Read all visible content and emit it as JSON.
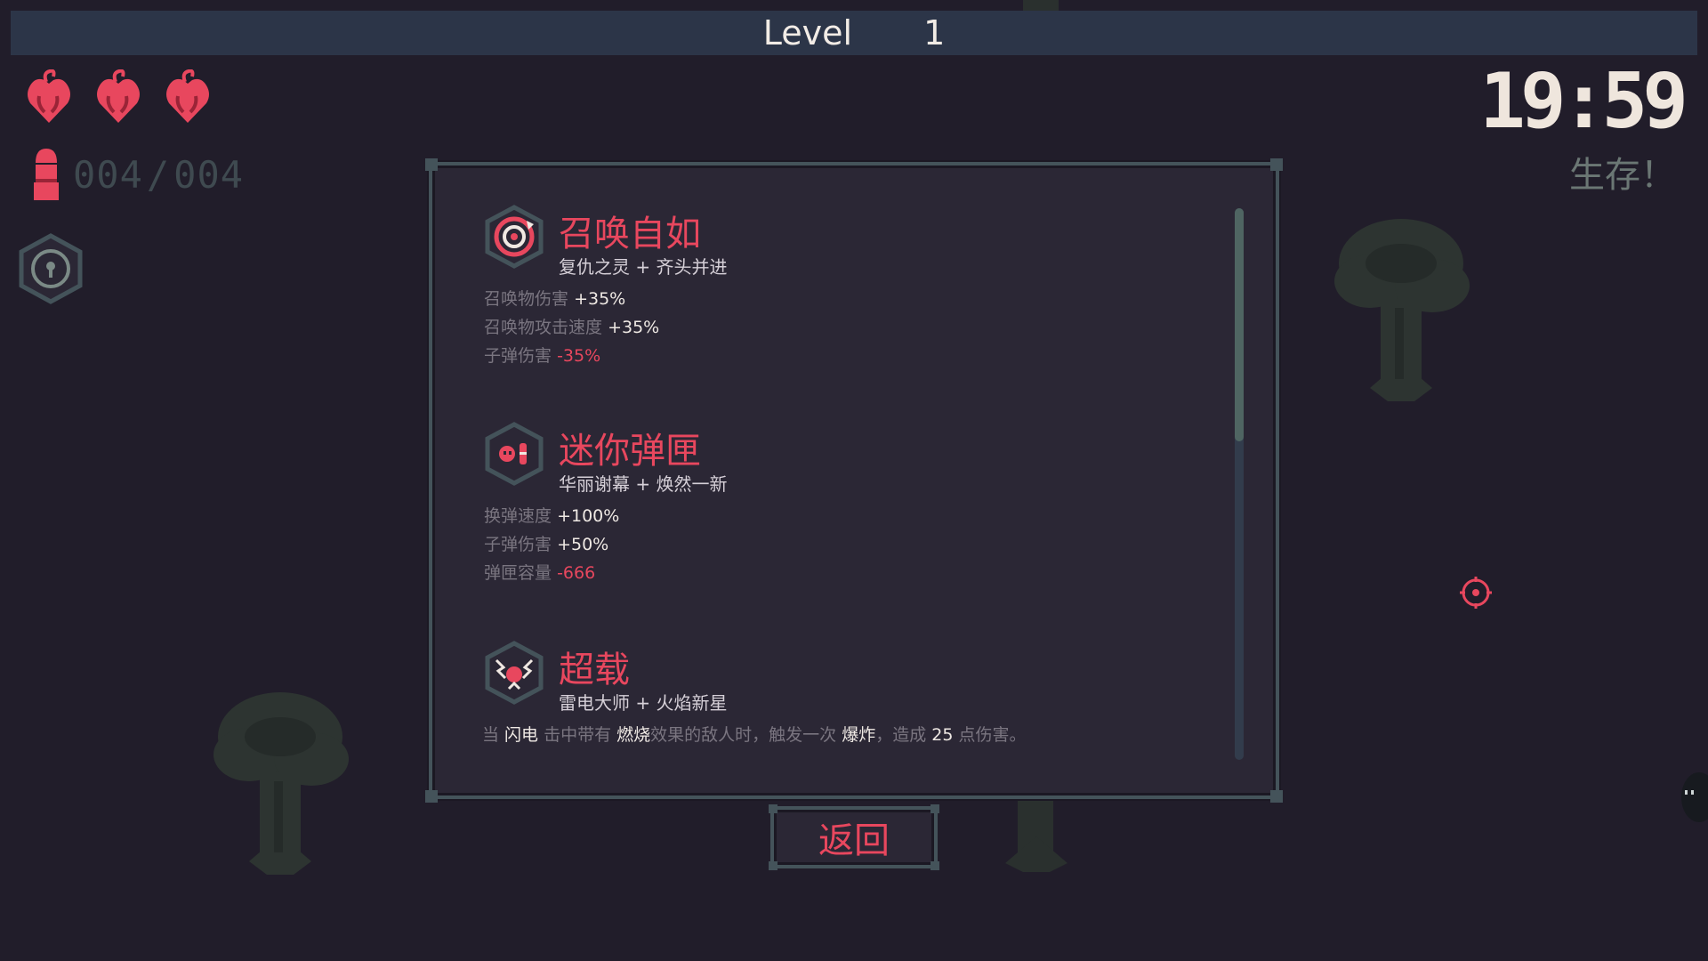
{
  "hud": {
    "level_label": "Level",
    "level_value": "1",
    "hearts": [
      "heart-icon",
      "heart-icon",
      "heart-icon"
    ],
    "ammo_current": "004",
    "ammo_separator": "/",
    "ammo_max": "004",
    "timer": "19:59",
    "objective": "生存！"
  },
  "upgrade_panel": {
    "scroll_position": 0.0,
    "upgrades": [
      {
        "icon": "summon-spiral-icon",
        "title": "召唤自如",
        "recipe": "复仇之灵 + 齐头并进",
        "stats": [
          {
            "label": "召唤物伤害",
            "value": "+35%",
            "type": "pos"
          },
          {
            "label": "召唤物攻击速度",
            "value": "+35%",
            "type": "pos"
          },
          {
            "label": "子弹伤害",
            "value": "-35%",
            "type": "neg"
          }
        ]
      },
      {
        "icon": "mini-clip-icon",
        "title": "迷你弹匣",
        "recipe": "华丽谢幕 + 焕然一新",
        "stats": [
          {
            "label": "换弹速度",
            "value": "+100%",
            "type": "pos"
          },
          {
            "label": "子弹伤害",
            "value": "+50%",
            "type": "pos"
          },
          {
            "label": "弹匣容量",
            "value": "-666",
            "type": "neg"
          }
        ]
      },
      {
        "icon": "overload-icon",
        "title": "超载",
        "recipe": "雷电大师 + 火焰新星",
        "description": {
          "p1": "当 ",
          "h1": "闪电",
          "p2": " 击中带有 ",
          "h2": "燃烧",
          "p3": "效果的敌人时，触发一次 ",
          "h3": "爆炸",
          "p4": "，造成 ",
          "h4": "25",
          "p5": " 点伤害。"
        }
      }
    ]
  },
  "back_button": {
    "label": "返回"
  },
  "colors": {
    "background": "#211d2a",
    "accent_red": "#e8475e",
    "panel_border": "#44535a",
    "panel_bg": "#2b2735",
    "level_bar": "#2c3548"
  }
}
